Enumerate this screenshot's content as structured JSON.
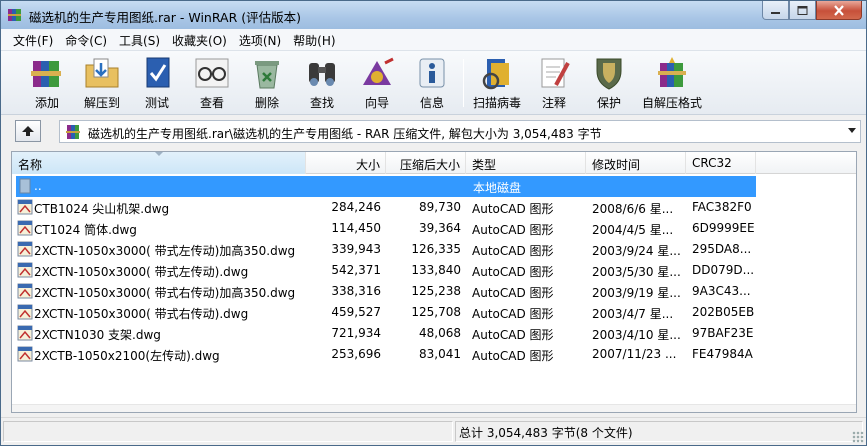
{
  "window": {
    "title": "磁选机的生产专用图纸.rar - WinRAR (评估版本)",
    "icons": {
      "app": "winrar-books-icon",
      "minimize": "minimize-icon",
      "maximize": "maximize-icon",
      "close": "close-icon"
    }
  },
  "menu": [
    "文件(F)",
    "命令(C)",
    "工具(S)",
    "收藏夹(O)",
    "选项(N)",
    "帮助(H)"
  ],
  "toolbar": {
    "add": "添加",
    "extract_to": "解压到",
    "test": "测试",
    "view": "查看",
    "delete": "删除",
    "find": "查找",
    "wizard": "向导",
    "info": "信息",
    "virus_scan": "扫描病毒",
    "comment": "注释",
    "protect": "保护",
    "sfx": "自解压格式"
  },
  "address": {
    "path": "磁选机的生产专用图纸.rar\\磁选机的生产专用图纸 - RAR 压缩文件, 解包大小为 3,054,483 字节"
  },
  "columns": {
    "name": "名称",
    "size": "大小",
    "packed": "压缩后大小",
    "type": "类型",
    "modified": "修改时间",
    "crc": "CRC32"
  },
  "parent_row": {
    "name": "..",
    "type": "本地磁盘"
  },
  "files": [
    {
      "name": "CTB1024 尖山机架.dwg",
      "size": "284,246",
      "packed": "89,730",
      "type": "AutoCAD 图形",
      "modified": "2008/6/6 星...",
      "crc": "FAC382F0"
    },
    {
      "name": "CT1024 筒体.dwg",
      "size": "114,450",
      "packed": "39,364",
      "type": "AutoCAD 图形",
      "modified": "2004/4/5 星...",
      "crc": "6D9999EE"
    },
    {
      "name": "2XCTN-1050x3000( 带式左传动)加高350.dwg",
      "size": "339,943",
      "packed": "126,335",
      "type": "AutoCAD 图形",
      "modified": "2003/9/24 星...",
      "crc": "295DA8..."
    },
    {
      "name": "2XCTN-1050x3000( 带式左传动).dwg",
      "size": "542,371",
      "packed": "133,840",
      "type": "AutoCAD 图形",
      "modified": "2003/5/30 星...",
      "crc": "DD079D..."
    },
    {
      "name": "2XCTN-1050x3000( 带式右传动)加高350.dwg",
      "size": "338,316",
      "packed": "125,238",
      "type": "AutoCAD 图形",
      "modified": "2003/9/19 星...",
      "crc": "9A3C43..."
    },
    {
      "name": "2XCTN-1050x3000( 带式右传动).dwg",
      "size": "459,527",
      "packed": "125,708",
      "type": "AutoCAD 图形",
      "modified": "2003/4/7 星...",
      "crc": "202B05EB"
    },
    {
      "name": "2XCTN1030 支架.dwg",
      "size": "721,934",
      "packed": "48,068",
      "type": "AutoCAD 图形",
      "modified": "2003/4/10 星...",
      "crc": "97BAF23E"
    },
    {
      "name": "2XCTB-1050x2100(左传动).dwg",
      "size": "253,696",
      "packed": "83,041",
      "type": "AutoCAD 图形",
      "modified": "2007/11/23 ...",
      "crc": "FE47984A"
    }
  ],
  "status": {
    "summary": "总计 3,054,483 字节(8 个文件)"
  },
  "colors": {
    "selection": "#3399ff",
    "title_gradient": "#a9c6e6"
  }
}
